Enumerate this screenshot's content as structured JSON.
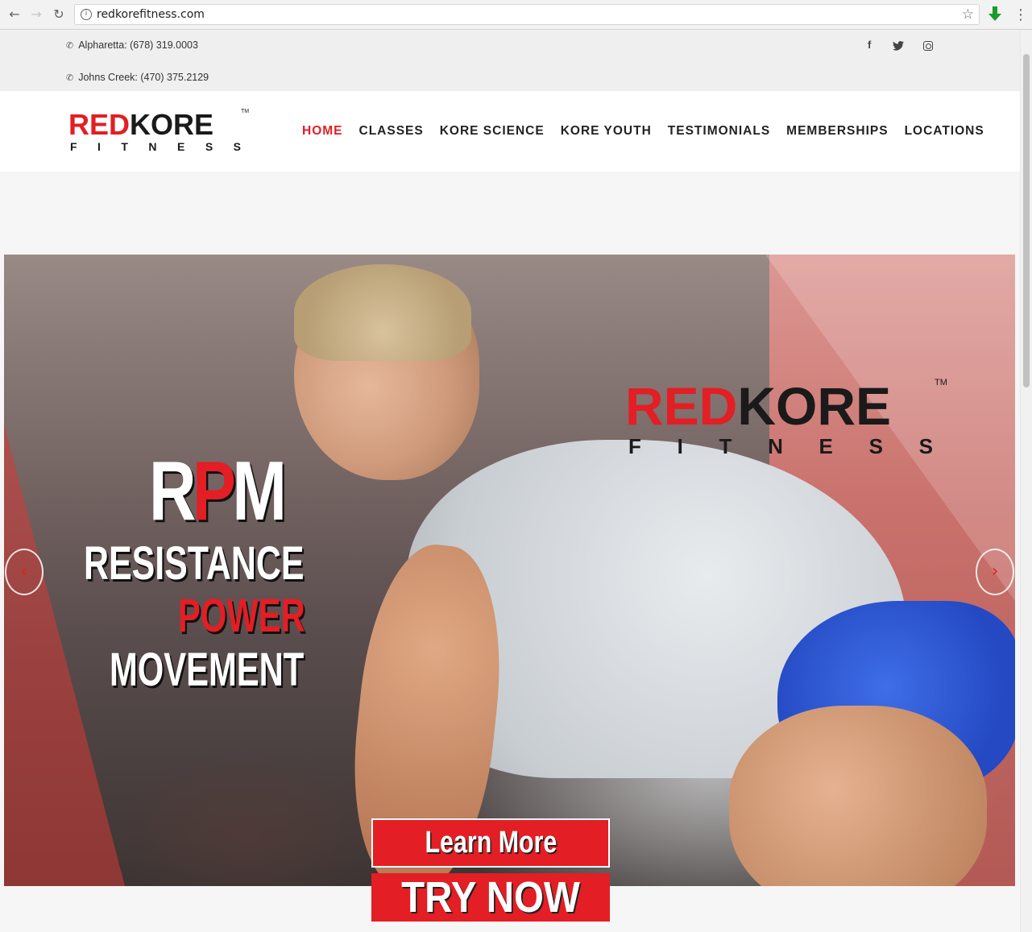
{
  "browser": {
    "url": "redkorefitness.com"
  },
  "topbar": {
    "phones": [
      {
        "label": "Alpharetta: (678) 319.0003"
      },
      {
        "label": "Johns Creek: (470) 375.2129"
      }
    ],
    "social": [
      "facebook-icon",
      "twitter-icon",
      "instagram-icon"
    ]
  },
  "logo": {
    "word_red": "RED",
    "word_black": "KORE",
    "letters": [
      "F",
      "I",
      "T",
      "N",
      "E",
      "S",
      "S"
    ],
    "tm": "TM"
  },
  "nav": {
    "items": [
      {
        "label": "HOME",
        "active": true
      },
      {
        "label": "CLASSES"
      },
      {
        "label": "KORE SCIENCE"
      },
      {
        "label": "KORE YOUTH"
      },
      {
        "label": "TESTIMONIALS"
      },
      {
        "label": "MEMBERSHIPS"
      },
      {
        "label": "LOCATIONS"
      }
    ]
  },
  "hero": {
    "rpm_r": "R",
    "rpm_p": "P",
    "rpm_m": "M",
    "line1": "RESISTANCE",
    "line2": "POWER",
    "line3": "MOVEMENT",
    "prev_icon": "‹",
    "next_icon": "›"
  },
  "cta": {
    "learn_more": "Learn More",
    "try_now": "TRY NOW"
  },
  "colors": {
    "brand_red": "#e31e24",
    "brand_black": "#1a1a1a"
  }
}
